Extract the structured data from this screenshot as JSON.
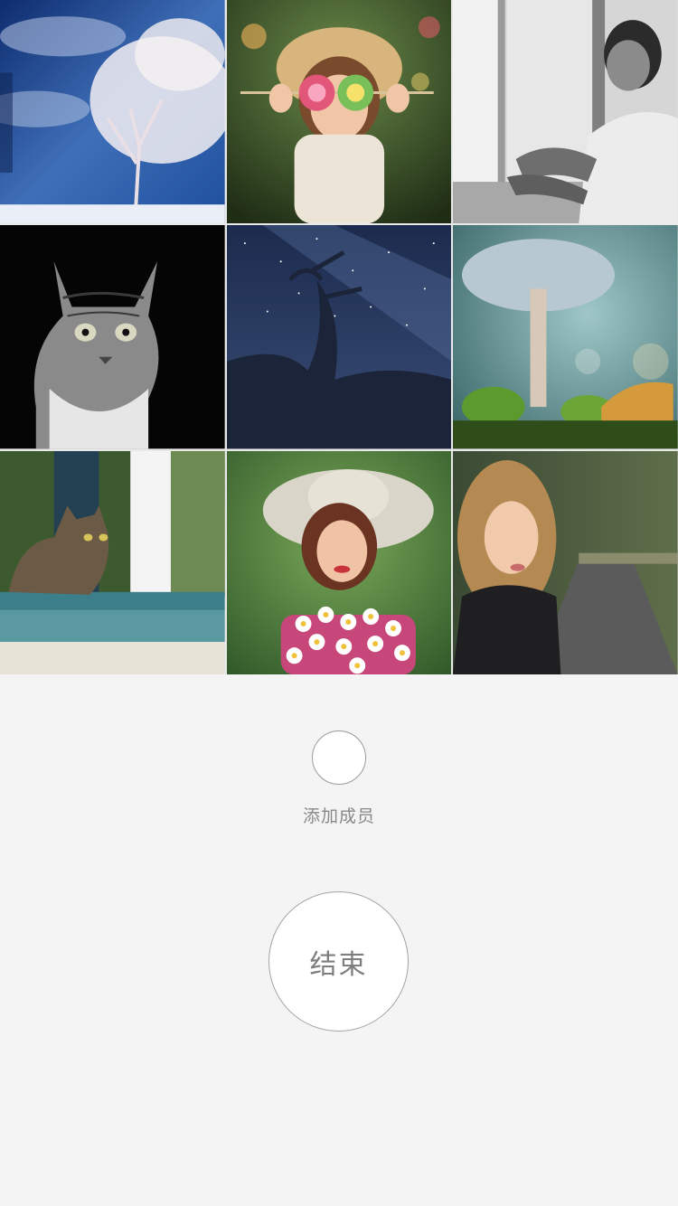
{
  "photo_grid": {
    "tiles": [
      {
        "icon": "snowy-tree-photo"
      },
      {
        "icon": "girl-with-lollipops-photo"
      },
      {
        "icon": "man-by-window-photo"
      },
      {
        "icon": "tabby-cat-portrait-photo"
      },
      {
        "icon": "starry-night-tree-photo"
      },
      {
        "icon": "mushroom-macro-photo"
      },
      {
        "icon": "cat-on-window-sill-photo"
      },
      {
        "icon": "woman-with-hat-and-flowers-photo"
      },
      {
        "icon": "woman-on-road-photo"
      }
    ]
  },
  "actions": {
    "add_member_label": "添加成员",
    "end_label": "结束"
  }
}
